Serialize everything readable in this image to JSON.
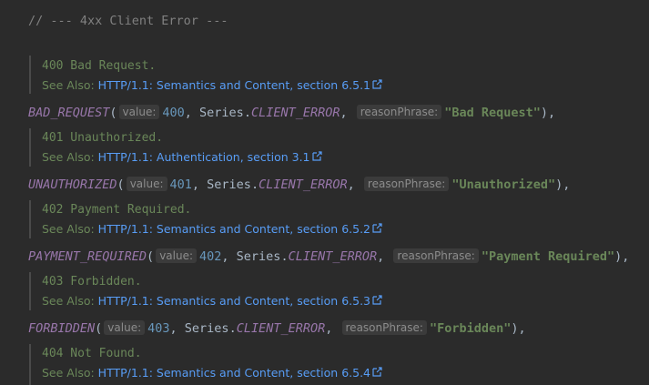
{
  "comment": "// --- 4xx Client Error ---",
  "entries": [
    {
      "doc_title": "400 Bad Request.",
      "see_also_label": "See Also:",
      "see_also_link": "HTTP/1.1: Semantics and Content, section 6.5.1",
      "constant": "BAD_REQUEST",
      "value_hint": "value:",
      "value": "400",
      "series_class": "Series",
      "series_field": "CLIENT_ERROR",
      "reason_hint": "reasonPhrase:",
      "reason": "\"Bad Request\""
    },
    {
      "doc_title": "401 Unauthorized.",
      "see_also_label": "See Also:",
      "see_also_link": "HTTP/1.1: Authentication, section 3.1",
      "constant": "UNAUTHORIZED",
      "value_hint": "value:",
      "value": "401",
      "series_class": "Series",
      "series_field": "CLIENT_ERROR",
      "reason_hint": "reasonPhrase:",
      "reason": "\"Unauthorized\""
    },
    {
      "doc_title": "402 Payment Required.",
      "see_also_label": "See Also:",
      "see_also_link": "HTTP/1.1: Semantics and Content, section 6.5.2",
      "constant": "PAYMENT_REQUIRED",
      "value_hint": "value:",
      "value": "402",
      "series_class": "Series",
      "series_field": "CLIENT_ERROR",
      "reason_hint": "reasonPhrase:",
      "reason": "\"Payment Required\""
    },
    {
      "doc_title": "403 Forbidden.",
      "see_also_label": "See Also:",
      "see_also_link": "HTTP/1.1: Semantics and Content, section 6.5.3",
      "constant": "FORBIDDEN",
      "value_hint": "value:",
      "value": "403",
      "series_class": "Series",
      "series_field": "CLIENT_ERROR",
      "reason_hint": "reasonPhrase:",
      "reason": "\"Forbidden\""
    },
    {
      "doc_title": "404 Not Found.",
      "see_also_label": "See Also:",
      "see_also_link": "HTTP/1.1: Semantics and Content, section 6.5.4"
    }
  ],
  "colors": {
    "background": "#2b2b2b",
    "comment": "#808080",
    "doc_text": "#6a8759",
    "link": "#589df6",
    "constant": "#9876aa",
    "number": "#6897bb",
    "string": "#6a8759",
    "hint_bg": "#3b3b3b",
    "hint_text": "#8c8c8c"
  },
  "icons": {
    "external_link": "external-link-icon"
  }
}
